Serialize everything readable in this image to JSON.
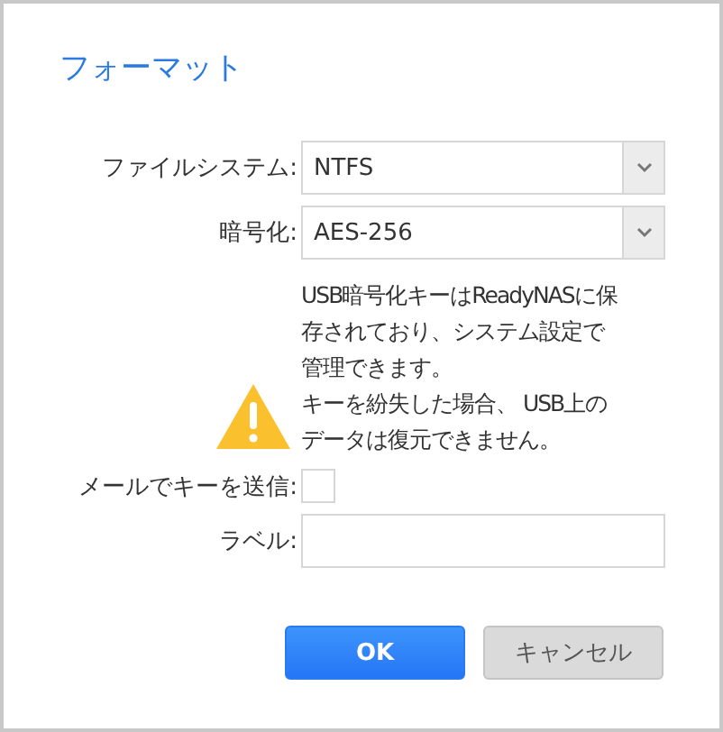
{
  "dialog": {
    "title": "フォーマット",
    "fields": [
      {
        "kind": "select",
        "label": "ファイルシステム:",
        "value": "NTFS"
      },
      {
        "kind": "select",
        "label": "暗号化:",
        "value": "AES-256"
      },
      {
        "kind": "note",
        "paragraphs": [
          "USB暗号化キーはReadyNASに保存されており、システム設定で管理できます。",
          "キーを紛失した場合、 USB上のデータは復元できません。"
        ]
      },
      {
        "kind": "checkbox",
        "label": "メールでキーを送信:",
        "checked": false
      },
      {
        "kind": "text",
        "label": "ラベル:"
      }
    ],
    "buttons": [
      {
        "kind": "primary",
        "label": "OK"
      },
      {
        "kind": "secondary",
        "label": "キャンセル"
      }
    ]
  }
}
